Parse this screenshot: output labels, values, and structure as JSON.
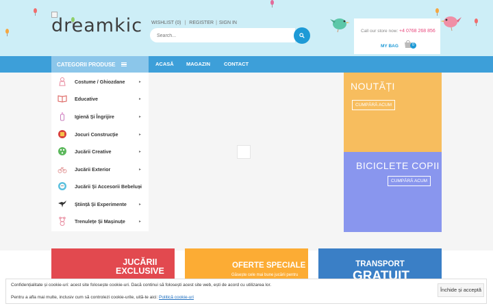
{
  "header": {
    "logo_text": "dreamkic",
    "links": {
      "wishlist": "WISHLIST (0)",
      "register": "REGISTER",
      "sign_in": "SIGN IN"
    },
    "search": {
      "placeholder": "Search..."
    },
    "cart": {
      "call_text": "Call our store now:",
      "phone": "+4 0768 268 856",
      "bag_label": "MY BAG",
      "count": "0"
    }
  },
  "nav": {
    "categories_label": "CATEGORII PRODUSE",
    "items": [
      "ACASĂ",
      "MAGAZIN",
      "CONTACT"
    ]
  },
  "sidebar": {
    "items": [
      {
        "label": "Costume / Ghiozdane",
        "icon": "costume-icon"
      },
      {
        "label": "Educative",
        "icon": "book-icon"
      },
      {
        "label": "Igienă Și Îngrijire",
        "icon": "baby-bottle-icon"
      },
      {
        "label": "Jocuri Construcție",
        "icon": "blocks-icon"
      },
      {
        "label": "Jucării Creative",
        "icon": "palette-icon"
      },
      {
        "label": "Jucării Exterior",
        "icon": "bike-icon"
      },
      {
        "label": "Jucării Și Accesorii Bebeluși",
        "icon": "baby-icon"
      },
      {
        "label": "Știință Și Experimente",
        "icon": "stork-icon"
      },
      {
        "label": "Trenulețe Și Mașinuțe",
        "icon": "teddy-icon"
      }
    ]
  },
  "promos": [
    {
      "title": "NOUTĂȚI",
      "button": "CUMPĂRĂ ACUM",
      "color": "#f7bd5e"
    },
    {
      "title": "BICICLETE COPII",
      "button": "CUMPĂRĂ ACUM",
      "color": "#8996ee"
    }
  ],
  "cards": [
    {
      "line1": "JUCĂRII",
      "line2": "EXCLUSIVE",
      "color": "#e2494f"
    },
    {
      "line1": "OFERTE SPECIALE",
      "sub": "Găsește cele mai bune jucării pentru",
      "color": "#fcac34"
    },
    {
      "line1": "TRANSPORT",
      "line2": "GRATUIT",
      "color": "#3a7fc6"
    }
  ],
  "cookie": {
    "text1": "Confidențialitate și cookie-uri: acest site folosește cookie-uri. Dacă continui să folosești acest site web, ești de acord cu utilizarea lor.",
    "text2": "Pentru a afla mai multe, inclusiv cum să controlezi cookie-urile, uită-te aici:",
    "link": "Politică cookie-uri",
    "button": "Închide și acceptă"
  },
  "colors": {
    "header_bg": "#cdeef7",
    "nav_bg": "#3d9fd9",
    "accent": "#1e9ad6",
    "phone": "#e8477c"
  }
}
